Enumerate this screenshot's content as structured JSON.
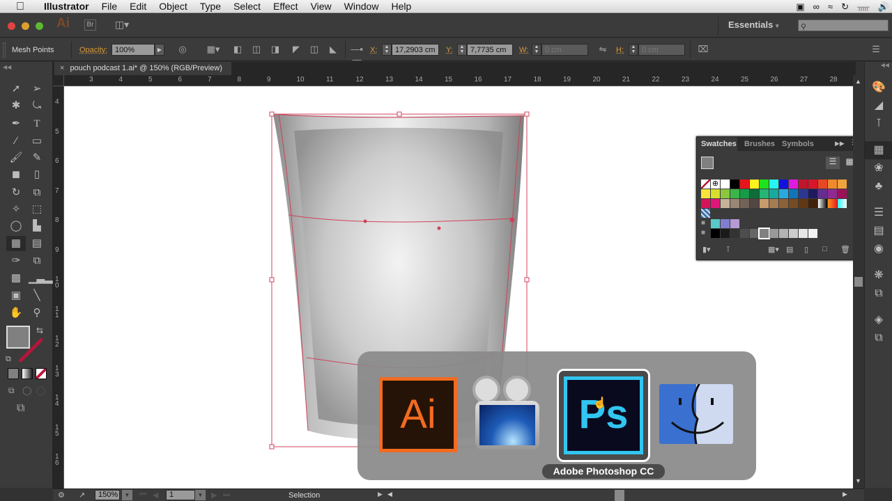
{
  "menubar": {
    "app_name": "Illustrator",
    "items": [
      "File",
      "Edit",
      "Object",
      "Type",
      "Select",
      "Effect",
      "View",
      "Window",
      "Help"
    ],
    "status_icons": [
      "screen-record-icon",
      "creative-cloud-icon",
      "wifi-icon",
      "time-machine-icon",
      "bluetooth-icon",
      "volume-icon"
    ]
  },
  "appbar": {
    "logo": "Ai",
    "bridge_label": "Br",
    "workspace": "Essentials",
    "search_placeholder": ""
  },
  "control": {
    "selection_label": "Mesh Points",
    "opacity_label": "Opacity:",
    "opacity_value": "100%",
    "x_label": "X:",
    "x_value": "17,2903 cm",
    "y_label": "Y:",
    "y_value": "7,7735 cm",
    "w_label": "W:",
    "w_value": "0 cm",
    "h_label": "H:",
    "h_value": "0 cm"
  },
  "document": {
    "tab_title": "pouch podcast 1.ai* @ 150% (RGB/Preview)",
    "close_glyph": "×"
  },
  "rulers": {
    "horizontal": [
      "3",
      "4",
      "5",
      "6",
      "7",
      "8",
      "9",
      "10",
      "11",
      "12",
      "13",
      "14",
      "15",
      "16",
      "17",
      "18",
      "19",
      "20",
      "21",
      "22",
      "23",
      "24",
      "25",
      "26",
      "27",
      "28"
    ],
    "vertical": [
      "4",
      "5",
      "6",
      "7",
      "8",
      "9",
      "10",
      "11",
      "12",
      "13",
      "14",
      "15",
      "16"
    ]
  },
  "swatches": {
    "tabs": [
      "Swatches",
      "Brushes",
      "Symbols"
    ],
    "active_tab": "Swatches",
    "row1": [
      "none",
      "registration",
      "#ffffff",
      "#000000",
      "#e8141b",
      "#fff21f",
      "#1de31d",
      "#29f4f4",
      "#1212dd",
      "#e01ae0",
      "#c0162b",
      "#d8152a",
      "#e64724",
      "#ee8a2b",
      "#f0a33c"
    ],
    "row2": [
      "#f8e43a",
      "#d6df2d",
      "#8dc63f",
      "#3cb548",
      "#169b48",
      "#0e6d38",
      "#25b574",
      "#17a99d",
      "#29a9e0",
      "#1474b8",
      "#2b3792",
      "#1f1a5e",
      "#652d90",
      "#8f2a91",
      "#9c1258"
    ],
    "row3": [
      "#d4145a",
      "#e2157a",
      "#c7b299",
      "#998675",
      "#736357",
      "#534741",
      "#c69c6d",
      "#a67c52",
      "#8c6239",
      "#754c24",
      "#603813",
      "#42210b",
      "gradient-bw",
      "gradient-orange",
      "gradient-cyan"
    ],
    "pattern_row": [
      "pattern-blue"
    ],
    "group1": [
      "#5ac8c8",
      "#7f7fcf",
      "#b59ad3"
    ],
    "group2": [
      "#000000",
      "#1a1a1a",
      "#333333",
      "#4d4d4d",
      "#666666",
      "#808080",
      "#999999",
      "#b3b3b3",
      "#cccccc",
      "#e6e6e6",
      "#f2f2f2"
    ],
    "selected_swatch": "#808080"
  },
  "dock": {
    "icons": [
      "color-icon",
      "color-guide-icon",
      "appearance-icon",
      "swatches-icon",
      "brushes-icon",
      "symbols-icon",
      "stroke-icon",
      "gradient-icon",
      "transparency-icon",
      "graphic-styles-icon",
      "transform-icon",
      "layers-icon",
      "artboards-icon"
    ]
  },
  "statusbar": {
    "zoom": "150%",
    "artboard": "1",
    "status_text": "Selection"
  },
  "switcher": {
    "apps": [
      {
        "name": "Adobe Illustrator CC",
        "glyph": "Ai",
        "color": "#ff7c00"
      },
      {
        "name": "ScreenFlow",
        "glyph": "camera"
      },
      {
        "name": "Adobe Photoshop CC",
        "glyph": "Ps",
        "color": "#31c5f0"
      },
      {
        "name": "Finder",
        "glyph": "finder"
      }
    ],
    "selected_label": "Adobe Photoshop CC"
  }
}
